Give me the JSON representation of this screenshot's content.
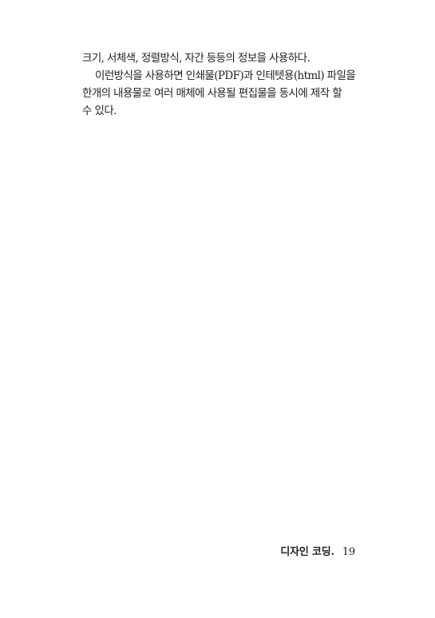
{
  "body": {
    "lines": [
      "크기, 서체색, 정렬방식, 자간 등등의 정보을 사용하다.",
      "이런방식을 사용하면 인쇄물(PDF)과 인테텟용(html) 파일을",
      "한개의 내용물로 여러 매체에 사용될 편집물을 동시에 제작 할",
      "수 있다."
    ]
  },
  "footer": {
    "section_title": "디자인 코딩.",
    "page_number": "19"
  }
}
